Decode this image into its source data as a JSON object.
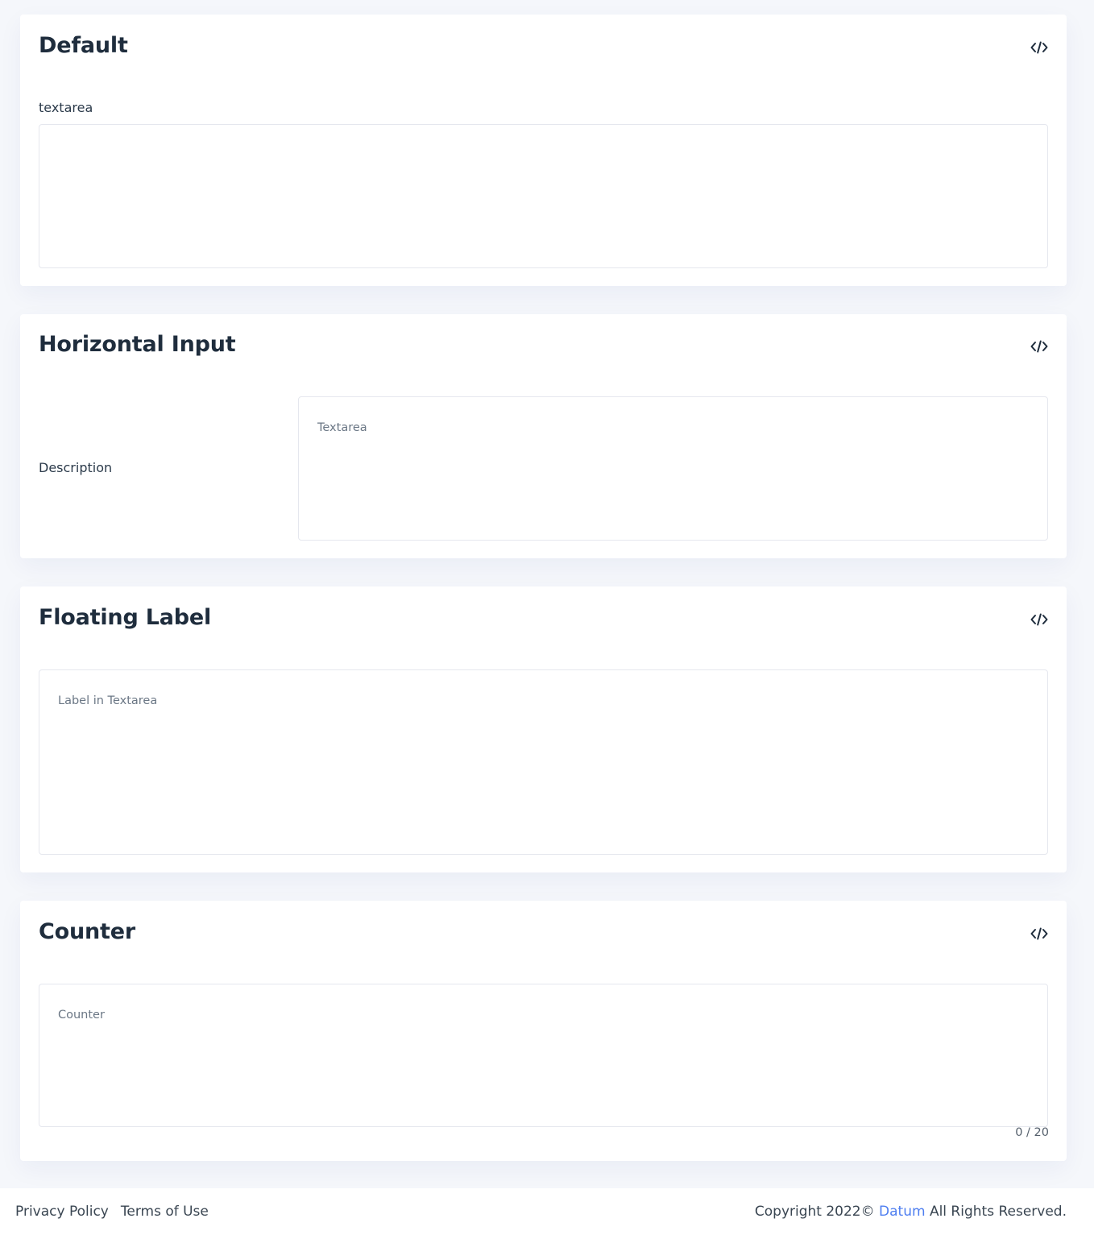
{
  "cards": {
    "default": {
      "title": "Default",
      "code_icon": "code-icon",
      "field_label": "textarea",
      "textarea_value": ""
    },
    "horizontal": {
      "title": "Horizontal Input",
      "code_icon": "code-icon",
      "field_label": "Description",
      "placeholder": "Textarea"
    },
    "floating": {
      "title": "Floating Label",
      "code_icon": "code-icon",
      "placeholder": "Label in Textarea"
    },
    "counter": {
      "title": "Counter",
      "code_icon": "code-icon",
      "placeholder": "Counter",
      "counter_text": "0 / 20"
    }
  },
  "footer": {
    "privacy": "Privacy Policy",
    "terms": "Terms of Use",
    "copyright_prefix": "Copyright 2022©",
    "brand": "Datum",
    "copyright_suffix": "All Rights Reserved."
  },
  "colors": {
    "page_background": "#f5f7fb",
    "card_background": "#ffffff",
    "brand_link": "#4e7ef0",
    "heading": "#1f2d3d"
  }
}
